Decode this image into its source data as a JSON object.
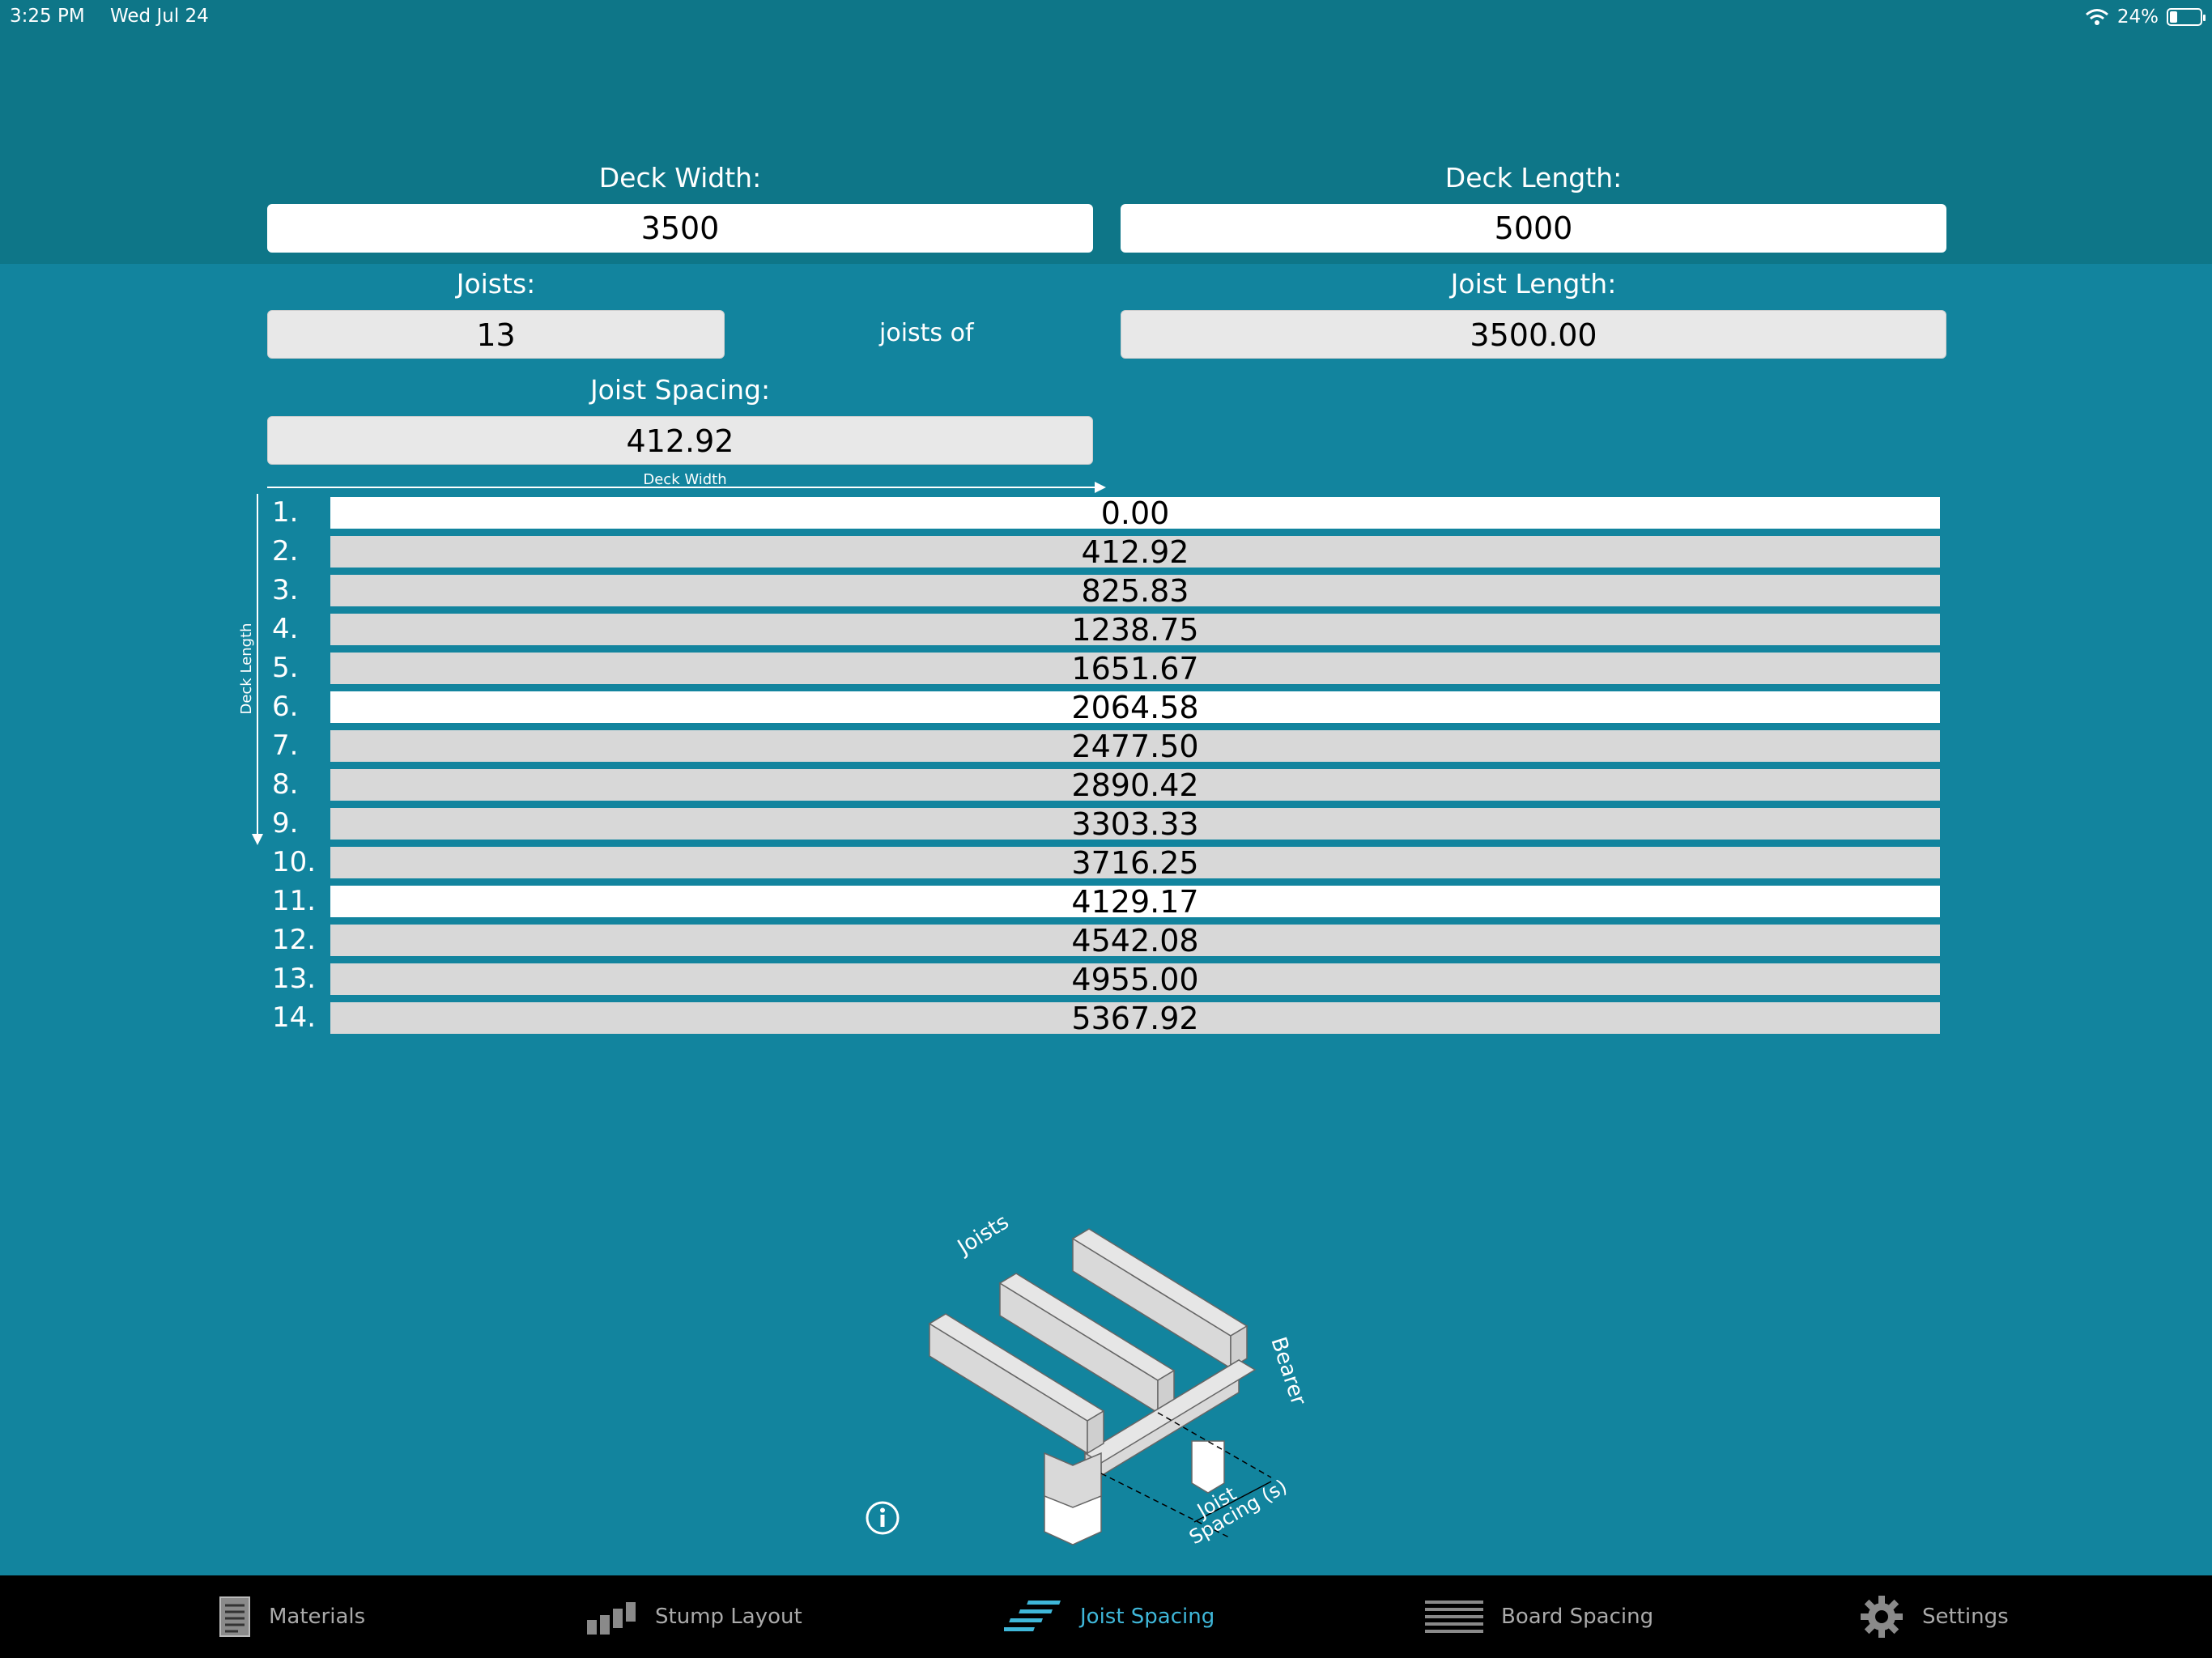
{
  "status_bar": {
    "time": "3:25 PM",
    "date": "Wed Jul 24",
    "battery_percent": "24%",
    "battery_level": 0.24
  },
  "inputs": {
    "deck_width": {
      "label": "Deck Width:",
      "value": "3500"
    },
    "deck_length": {
      "label": "Deck Length:",
      "value": "5000"
    },
    "joists": {
      "label": "Joists:",
      "value": "13"
    },
    "joists_of": "joists of",
    "joist_length": {
      "label": "Joist Length:",
      "value": "3500.00"
    },
    "joist_spacing": {
      "label": "Joist Spacing:",
      "value": "412.92"
    }
  },
  "axes": {
    "deck_width": "Deck Width",
    "deck_length": "Deck Length"
  },
  "rows": [
    {
      "num": "1.",
      "value": "0.00"
    },
    {
      "num": "2.",
      "value": "412.92"
    },
    {
      "num": "3.",
      "value": "825.83"
    },
    {
      "num": "4.",
      "value": "1238.75"
    },
    {
      "num": "5.",
      "value": "1651.67"
    },
    {
      "num": "6.",
      "value": "2064.58"
    },
    {
      "num": "7.",
      "value": "2477.50"
    },
    {
      "num": "8.",
      "value": "2890.42"
    },
    {
      "num": "9.",
      "value": "3303.33"
    },
    {
      "num": "10.",
      "value": "3716.25"
    },
    {
      "num": "11.",
      "value": "4129.17"
    },
    {
      "num": "12.",
      "value": "4542.08"
    },
    {
      "num": "13.",
      "value": "4955.00"
    },
    {
      "num": "14.",
      "value": "5367.92"
    }
  ],
  "illustration": {
    "joists": "Joists",
    "bearer": "Bearer",
    "joist_spacing_1": "Joist",
    "joist_spacing_2": "Spacing (s)"
  },
  "tabs": [
    {
      "label": "Materials",
      "icon": "materials-icon"
    },
    {
      "label": "Stump Layout",
      "icon": "stump-layout-icon"
    },
    {
      "label": "Joist Spacing",
      "icon": "joist-spacing-icon",
      "active": true
    },
    {
      "label": "Board Spacing",
      "icon": "board-spacing-icon"
    },
    {
      "label": "Settings",
      "icon": "gear-icon"
    }
  ],
  "colors": {
    "background": "#12849e",
    "header": "#0e7688",
    "accent": "#3fb7d9",
    "tabbar": "#000000"
  }
}
